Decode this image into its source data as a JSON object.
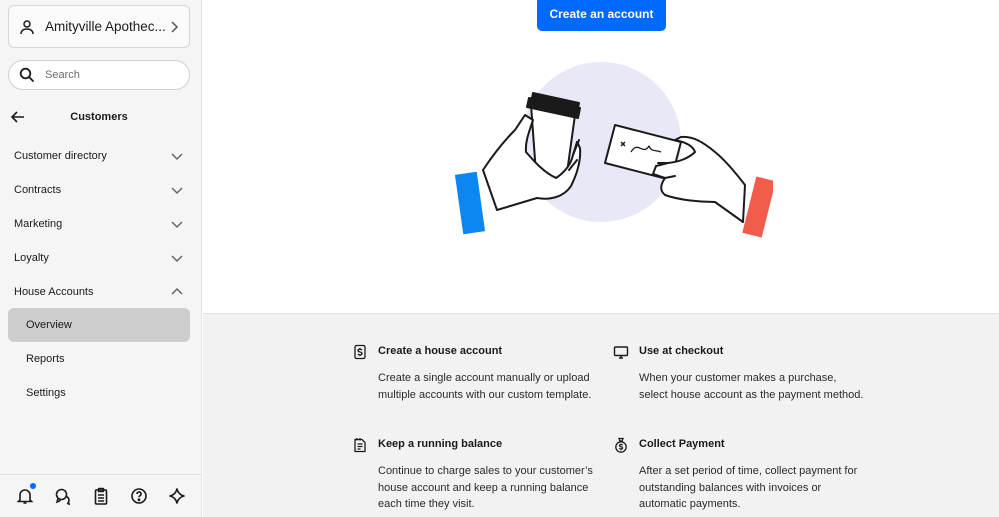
{
  "sidebar": {
    "location_name": "Amityville Apothec...",
    "search_placeholder": "Search",
    "section_title": "Customers",
    "nav_items": [
      {
        "label": "Customer directory",
        "expanded": false
      },
      {
        "label": "Contracts",
        "expanded": false
      },
      {
        "label": "Marketing",
        "expanded": false
      },
      {
        "label": "Loyalty",
        "expanded": false
      },
      {
        "label": "House Accounts",
        "expanded": true
      }
    ],
    "sub_items": [
      {
        "label": "Overview",
        "active": true
      },
      {
        "label": "Reports",
        "active": false
      },
      {
        "label": "Settings",
        "active": false
      }
    ],
    "bottom_icons": [
      "bell-icon",
      "chat-icon",
      "clipboard-icon",
      "help-icon",
      "sparkle-icon"
    ],
    "notification_dot_color": "#006aff"
  },
  "main": {
    "create_button_label": "Create an account",
    "accent_color": "#006aff",
    "features": [
      {
        "icon": "receipt-icon",
        "title": "Create a house account",
        "description": "Create a single account manually or upload multiple accounts with our custom template."
      },
      {
        "icon": "monitor-icon",
        "title": "Use at checkout",
        "description": "When your customer makes a purchase, select house account as the payment method."
      },
      {
        "icon": "list-receipt-icon",
        "title": "Keep a running balance",
        "description": "Continue to charge sales to your customer’s house account and keep a running balance each time they visit."
      },
      {
        "icon": "money-bag-icon",
        "title": "Collect Payment",
        "description": "After a set period of time, collect payment for outstanding balances with invoices or automatic payments."
      }
    ]
  }
}
